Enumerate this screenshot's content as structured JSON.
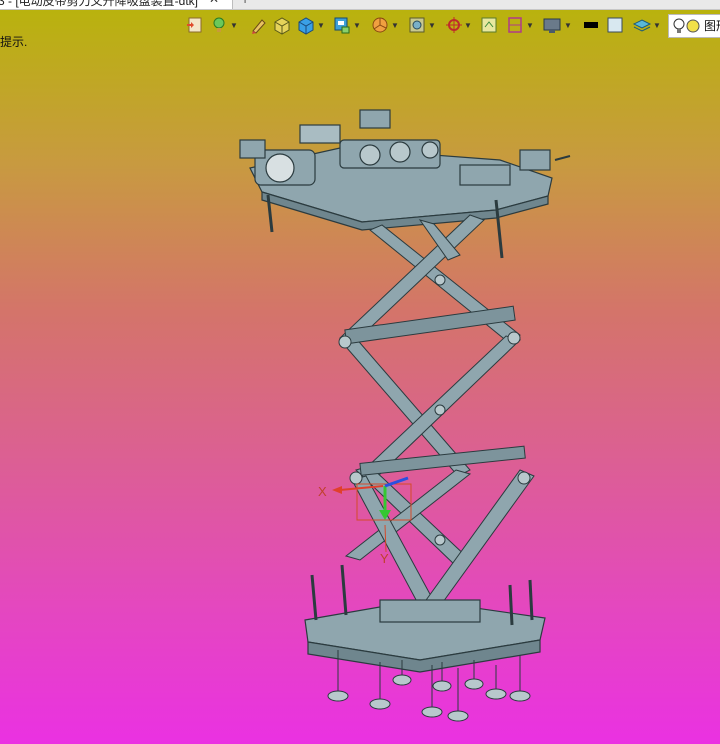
{
  "tab": {
    "title": "3 - [电动皮带剪刀叉升降吸盘装置-dtk]",
    "close": "✕",
    "new_tab": "+"
  },
  "hint": "提示.",
  "render_mode": {
    "label": "图形"
  },
  "triad": {
    "x_label": "X",
    "y_label": "Y"
  },
  "toolbar_icons": [
    "document-icon",
    "light-bulb-icon",
    "pencil-icon",
    "cube-shaded-icon",
    "cube-blue-icon",
    "view-orient-icon",
    "pie-section-icon",
    "edit-appearance-icon",
    "snap-icon",
    "window-icon",
    "align-icon",
    "monitor-icon",
    "black-rect-icon",
    "white-rect-icon",
    "layers-icon",
    "bulb-outline-icon",
    "yellow-dot-icon"
  ],
  "colors": {
    "model_fill": "#8fa6ae",
    "model_stroke": "#2b3b3f",
    "x_axis": "#e0402c",
    "y_axis": "#35c832",
    "z_axis": "#2a50e0"
  }
}
